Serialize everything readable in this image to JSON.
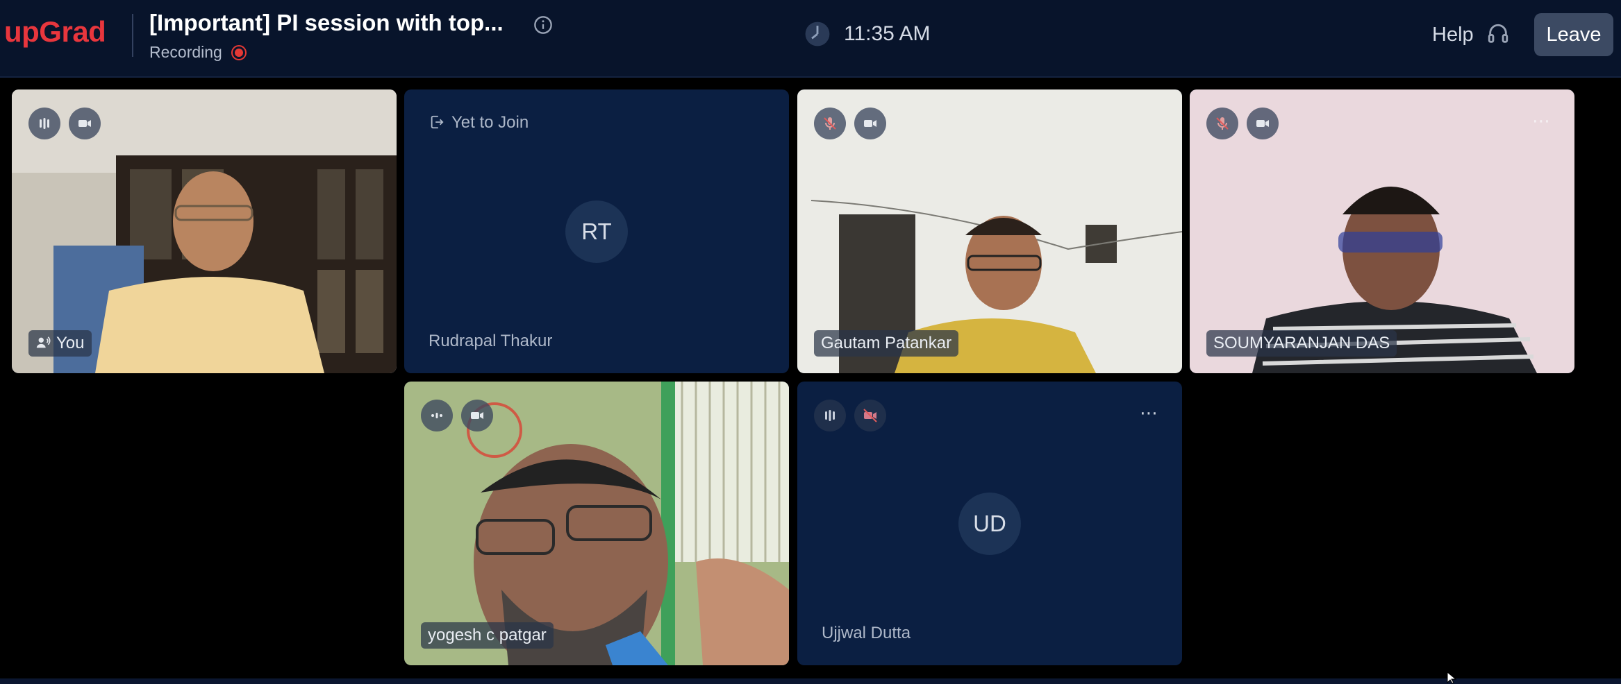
{
  "header": {
    "logo": "upGrad",
    "title": "[Important] PI session with top...",
    "recording_label": "Recording",
    "time": "11:35 AM",
    "help_label": "Help",
    "leave_label": "Leave"
  },
  "participants": [
    {
      "name": "You",
      "mic": "active",
      "camera": "on"
    },
    {
      "name": "Rudrapal Thakur",
      "status": "Yet to Join",
      "initials": "RT"
    },
    {
      "name": "Gautam Patankar",
      "mic": "muted",
      "camera": "on"
    },
    {
      "name": "SOUMYARANJAN DAS",
      "mic": "muted",
      "camera": "on"
    },
    {
      "name": "yogesh c patgar",
      "mic": "speaking",
      "camera": "on"
    },
    {
      "name": "Ujjwal Dutta",
      "initials": "UD",
      "mic": "active",
      "camera": "off"
    }
  ],
  "colors": {
    "brand": "#e8363d",
    "header_bg": "#08142b",
    "tile_bg": "#0b1f42",
    "recording": "#e53935"
  }
}
